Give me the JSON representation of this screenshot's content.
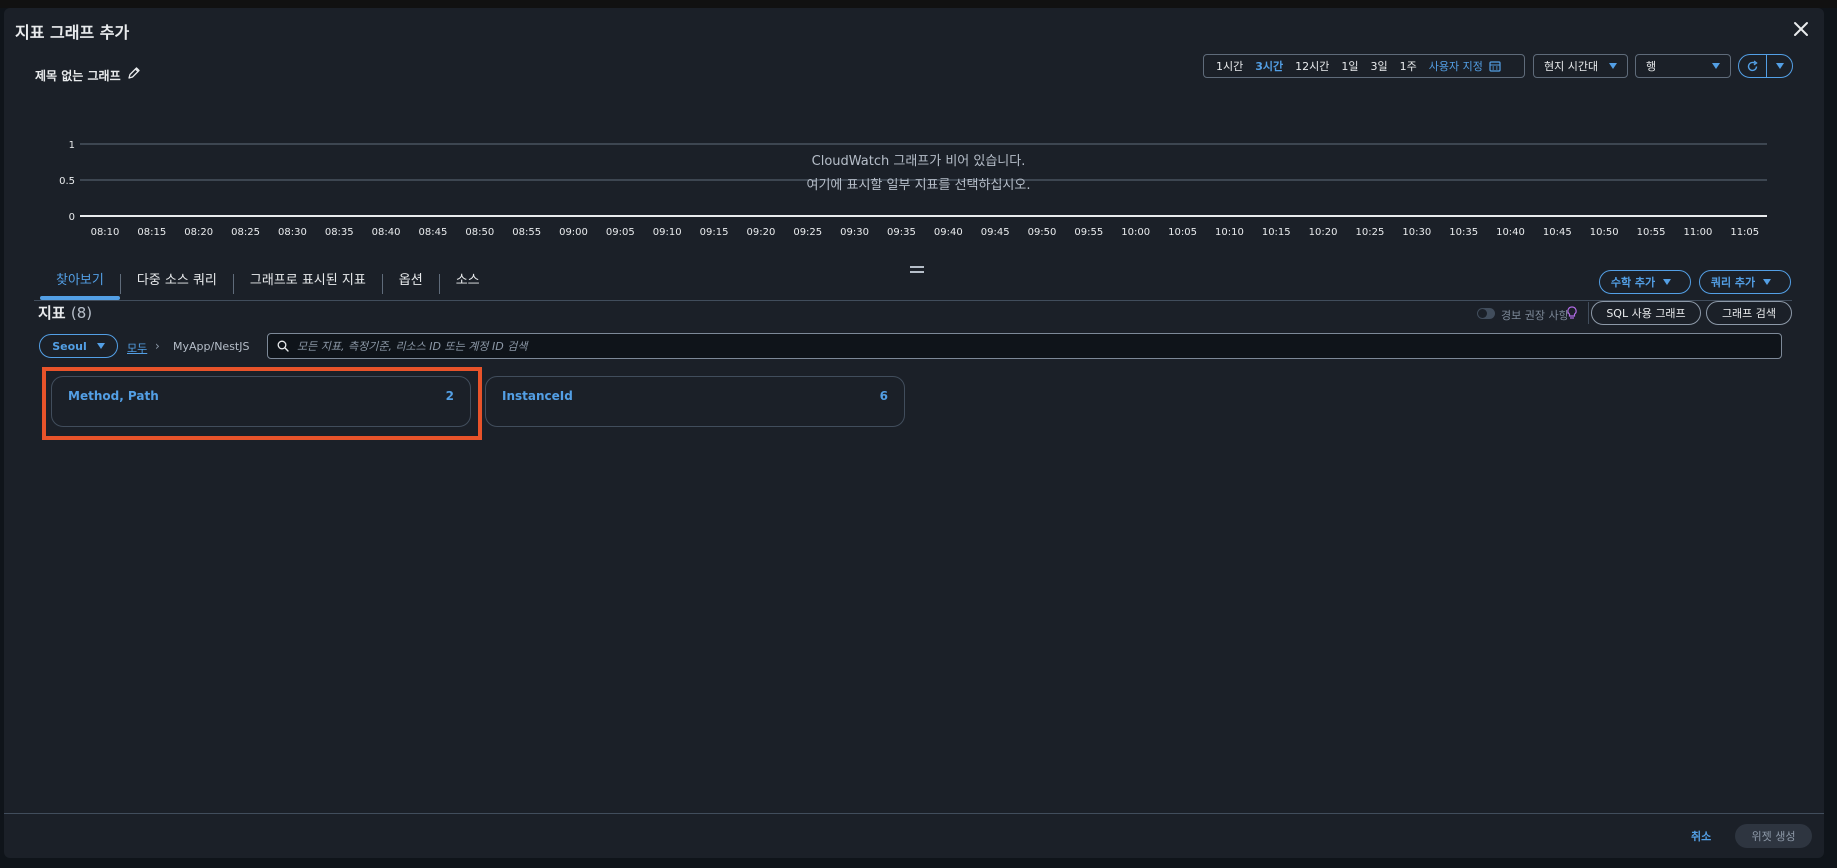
{
  "window": {
    "title": "지표 그래프 추가"
  },
  "graph": {
    "title": "제목 없는 그래프"
  },
  "time_range": {
    "options": [
      "1시간",
      "3시간",
      "12시간",
      "1일",
      "3일",
      "1주"
    ],
    "active": "3시간",
    "custom_label": "사용자 지정"
  },
  "timezone_select": {
    "value": "현지 시간대"
  },
  "view_select": {
    "value": "행"
  },
  "empty_state": {
    "title": "CloudWatch 그래프가 비어 있습니다.",
    "subtitle": "여기에 표시할 일부 지표를 선택하십시오."
  },
  "chart_data": {
    "type": "line",
    "title": "",
    "xlabel": "",
    "ylabel": "",
    "y_ticks": [
      "1",
      "0.5",
      "0"
    ],
    "ylim": [
      0,
      1
    ],
    "x_ticks": [
      "08:10",
      "08:15",
      "08:20",
      "08:25",
      "08:30",
      "08:35",
      "08:40",
      "08:45",
      "08:50",
      "08:55",
      "09:00",
      "09:05",
      "09:10",
      "09:15",
      "09:20",
      "09:25",
      "09:30",
      "09:35",
      "09:40",
      "09:45",
      "09:50",
      "09:55",
      "10:00",
      "10:05",
      "10:10",
      "10:15",
      "10:20",
      "10:25",
      "10:30",
      "10:35",
      "10:40",
      "10:45",
      "10:50",
      "10:55",
      "11:00",
      "11:05"
    ],
    "series": [],
    "grid": true
  },
  "tabs": [
    {
      "label": "찾아보기",
      "active": true
    },
    {
      "label": "다중 소스 쿼리"
    },
    {
      "label": "그래프로 표시된 지표"
    },
    {
      "label": "옵션"
    },
    {
      "label": "소스"
    }
  ],
  "actions": {
    "add_math": "수학 추가",
    "add_query": "쿼리 추가"
  },
  "metrics": {
    "heading": "지표",
    "count": "(8)",
    "alarm_recommendations_label": "경보 권장 사항",
    "sql_graph_button": "SQL 사용 그래프",
    "graph_search_button": "그래프 검색",
    "region": "Seoul",
    "breadcrumb_all": "모두",
    "breadcrumb_namespace": "MyApp/NestJS",
    "search_placeholder": "모든 지표, 측정기준, 리소스 ID 또는 계정 ID 검색",
    "dimensions": [
      {
        "name": "Method, Path",
        "count": "2"
      },
      {
        "name": "InstanceId",
        "count": "6"
      }
    ]
  },
  "footer": {
    "cancel": "취소",
    "create": "위젯 생성"
  },
  "colors": {
    "accent": "#539fe5",
    "highlight": "#e8532a",
    "background": "#1b2028"
  }
}
